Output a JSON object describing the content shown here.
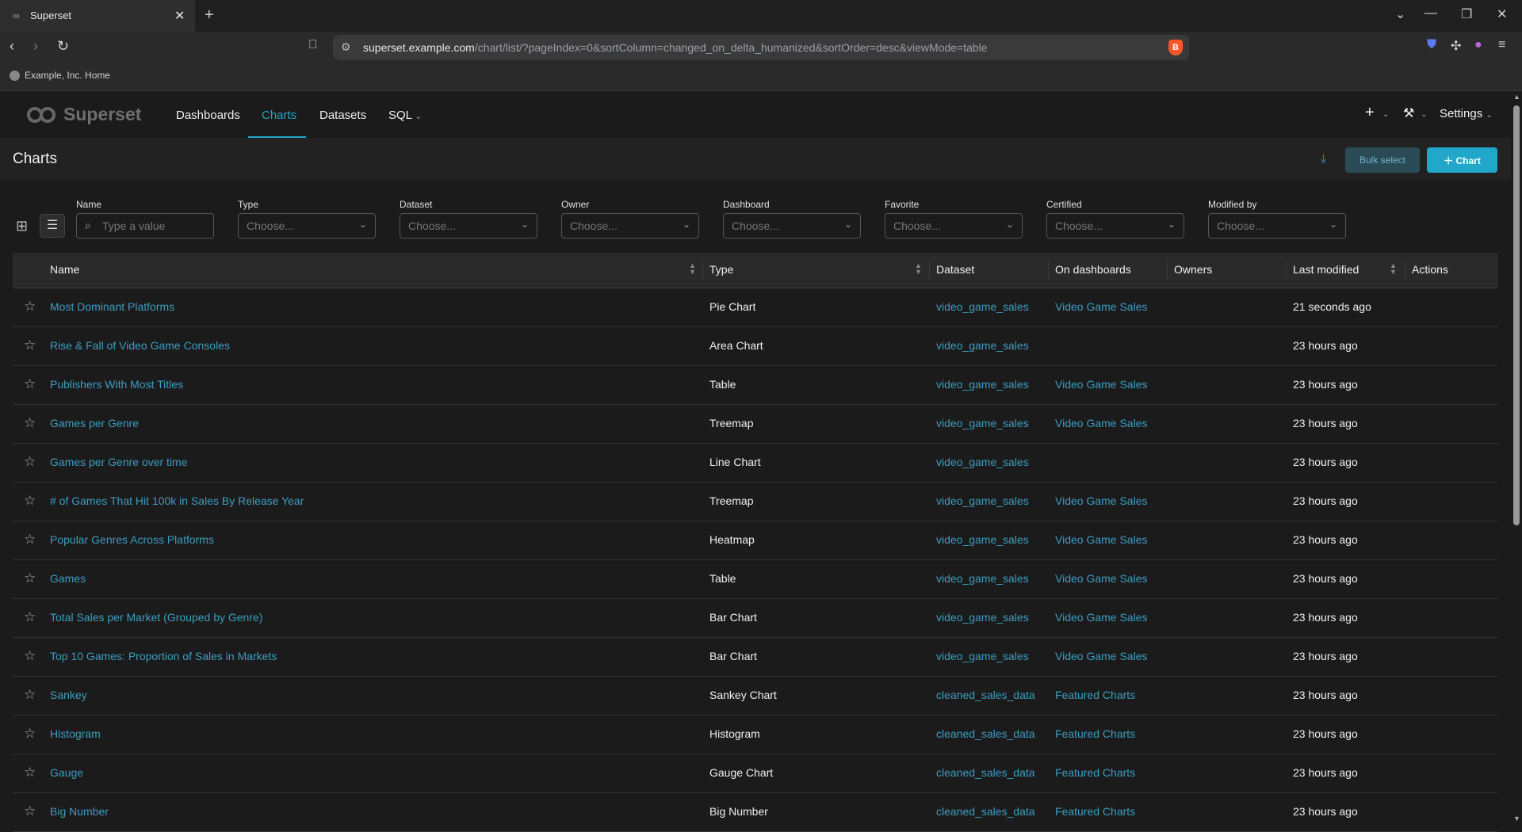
{
  "browser": {
    "tab_title": "Superset",
    "url_host": "superset.example.com",
    "url_path": "/chart/list/?pageIndex=0&sortColumn=changed_on_delta_humanized&sortOrder=desc&viewMode=table",
    "bookmark": "Example, Inc. Home"
  },
  "nav": {
    "brand": "Superset",
    "links": [
      "Dashboards",
      "Charts",
      "Datasets",
      "SQL"
    ],
    "settings": "Settings"
  },
  "page": {
    "title": "Charts",
    "bulk_select": "Bulk select",
    "add_chart": "Chart"
  },
  "filters": [
    {
      "label": "Name",
      "placeholder": "Type a value"
    },
    {
      "label": "Type",
      "placeholder": "Choose..."
    },
    {
      "label": "Dataset",
      "placeholder": "Choose..."
    },
    {
      "label": "Owner",
      "placeholder": "Choose..."
    },
    {
      "label": "Dashboard",
      "placeholder": "Choose..."
    },
    {
      "label": "Favorite",
      "placeholder": "Choose..."
    },
    {
      "label": "Certified",
      "placeholder": "Choose..."
    },
    {
      "label": "Modified by",
      "placeholder": "Choose..."
    }
  ],
  "table": {
    "columns": [
      "Name",
      "Type",
      "Dataset",
      "On dashboards",
      "Owners",
      "Last modified",
      "Actions"
    ],
    "rows": [
      {
        "name": "Most Dominant Platforms",
        "type": "Pie Chart",
        "dataset": "video_game_sales",
        "dashboard": "Video Game Sales",
        "modified": "21 seconds ago"
      },
      {
        "name": "Rise & Fall of Video Game Consoles",
        "type": "Area Chart",
        "dataset": "video_game_sales",
        "dashboard": "",
        "modified": "23 hours ago"
      },
      {
        "name": "Publishers With Most Titles",
        "type": "Table",
        "dataset": "video_game_sales",
        "dashboard": "Video Game Sales",
        "modified": "23 hours ago"
      },
      {
        "name": "Games per Genre",
        "type": "Treemap",
        "dataset": "video_game_sales",
        "dashboard": "Video Game Sales",
        "modified": "23 hours ago"
      },
      {
        "name": "Games per Genre over time",
        "type": "Line Chart",
        "dataset": "video_game_sales",
        "dashboard": "",
        "modified": "23 hours ago"
      },
      {
        "name": "# of Games That Hit 100k in Sales By Release Year",
        "type": "Treemap",
        "dataset": "video_game_sales",
        "dashboard": "Video Game Sales",
        "modified": "23 hours ago"
      },
      {
        "name": "Popular Genres Across Platforms",
        "type": "Heatmap",
        "dataset": "video_game_sales",
        "dashboard": "Video Game Sales",
        "modified": "23 hours ago"
      },
      {
        "name": "Games",
        "type": "Table",
        "dataset": "video_game_sales",
        "dashboard": "Video Game Sales",
        "modified": "23 hours ago"
      },
      {
        "name": "Total Sales per Market (Grouped by Genre)",
        "type": "Bar Chart",
        "dataset": "video_game_sales",
        "dashboard": "Video Game Sales",
        "modified": "23 hours ago"
      },
      {
        "name": "Top 10 Games: Proportion of Sales in Markets",
        "type": "Bar Chart",
        "dataset": "video_game_sales",
        "dashboard": "Video Game Sales",
        "modified": "23 hours ago"
      },
      {
        "name": "Sankey",
        "type": "Sankey Chart",
        "dataset": "cleaned_sales_data",
        "dashboard": "Featured Charts",
        "modified": "23 hours ago"
      },
      {
        "name": "Histogram",
        "type": "Histogram",
        "dataset": "cleaned_sales_data",
        "dashboard": "Featured Charts",
        "modified": "23 hours ago"
      },
      {
        "name": "Gauge",
        "type": "Gauge Chart",
        "dataset": "cleaned_sales_data",
        "dashboard": "Featured Charts",
        "modified": "23 hours ago"
      },
      {
        "name": "Big Number",
        "type": "Big Number",
        "dataset": "cleaned_sales_data",
        "dashboard": "Featured Charts",
        "modified": "23 hours ago"
      }
    ]
  },
  "colors": {
    "accent": "#20a7c9",
    "link": "#3c9dc0",
    "background": "#1b1b1b"
  }
}
